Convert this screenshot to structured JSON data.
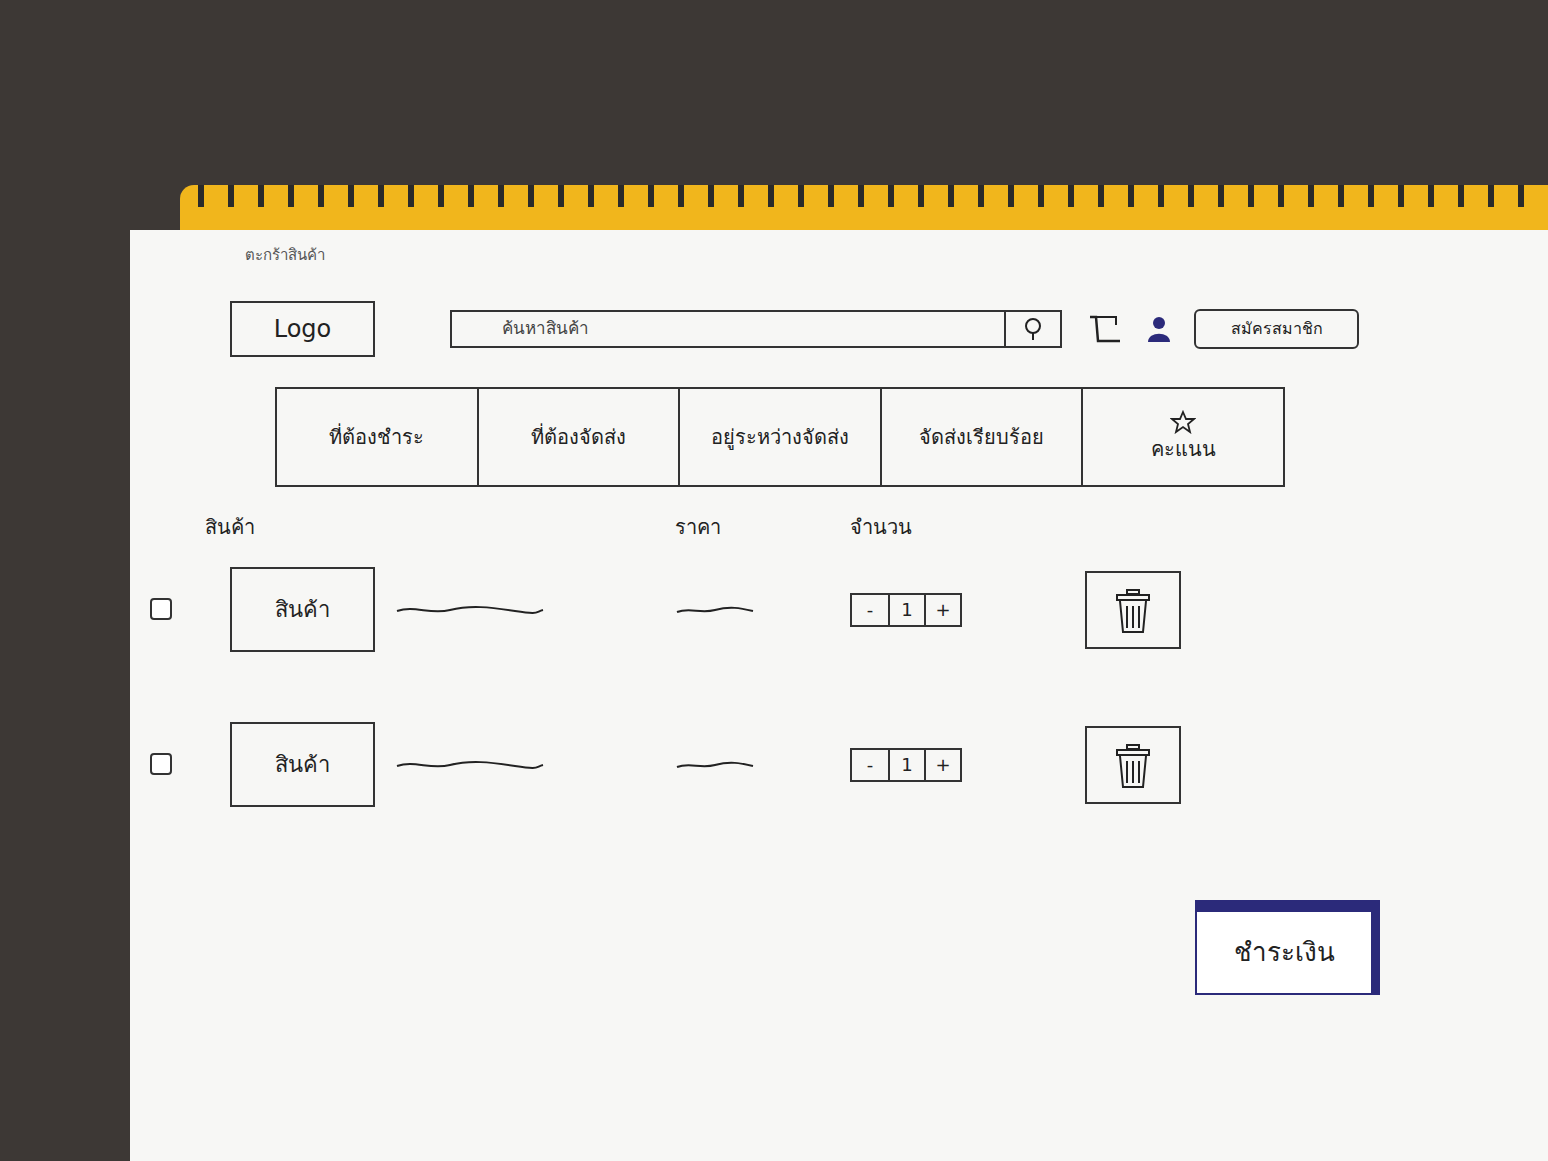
{
  "page": {
    "caption": "ตะกร้าสินค้า"
  },
  "header": {
    "logo": "Logo",
    "search": {
      "placeholder": "ค้นหาสินค้า"
    },
    "register_button": "สมัครสมาชิก"
  },
  "tabs": [
    {
      "label": "ที่ต้องชำระ",
      "selected": false,
      "kind": "plain"
    },
    {
      "label": "ที่ต้องจัดส่ง",
      "selected": false,
      "kind": "plain"
    },
    {
      "label": "อยู่ระหว่างจัดส่ง",
      "selected": false,
      "kind": "plain"
    },
    {
      "label": "จัดส่งเรียบร้อย",
      "selected": false,
      "kind": "plain"
    },
    {
      "label": "คะแนน",
      "selected": false,
      "kind": "star"
    }
  ],
  "columns": [
    "สินค้า",
    "ราคา",
    "จำนวน"
  ],
  "items": [
    {
      "checked": false,
      "image_label": "สินค้า",
      "decrement": "-",
      "quantity": "1",
      "increment": "+"
    },
    {
      "checked": false,
      "image_label": "สินค้า",
      "decrement": "-",
      "quantity": "1",
      "increment": "+"
    }
  ],
  "checkout_button": "ชำระเงิน"
}
